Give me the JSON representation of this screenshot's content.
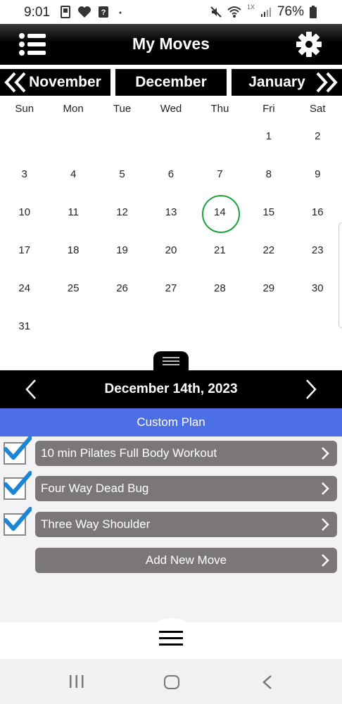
{
  "status": {
    "time": "9:01",
    "battery": "76%",
    "network_badge": "1X",
    "icons": [
      "phone-icon",
      "heart-shield-icon",
      "question-icon",
      "dot-icon",
      "mute-icon",
      "wifi-icon",
      "signal-icon",
      "battery-icon"
    ]
  },
  "header": {
    "title": "My Moves"
  },
  "months": {
    "prev": "November",
    "current": "December",
    "next": "January"
  },
  "weekdays": [
    "Sun",
    "Mon",
    "Tue",
    "Wed",
    "Thu",
    "Fri",
    "Sat"
  ],
  "calendar": {
    "weeks": [
      [
        "",
        "",
        "",
        "",
        "",
        "1",
        "2"
      ],
      [
        "3",
        "4",
        "5",
        "6",
        "7",
        "8",
        "9"
      ],
      [
        "10",
        "11",
        "12",
        "13",
        "14",
        "15",
        "16"
      ],
      [
        "17",
        "18",
        "19",
        "20",
        "21",
        "22",
        "23"
      ],
      [
        "24",
        "25",
        "26",
        "27",
        "28",
        "29",
        "30"
      ],
      [
        "31",
        "",
        "",
        "",
        "",
        "",
        ""
      ]
    ],
    "today": "14",
    "today_ring_color": "#1aa33a"
  },
  "selected_date": "December 14th, 2023",
  "plan": {
    "title": "Custom Plan",
    "color": "#4d6fe6"
  },
  "moves": [
    {
      "label": "10 min Pilates Full Body Workout",
      "checked": true
    },
    {
      "label": "Four Way Dead Bug",
      "checked": true
    },
    {
      "label": "Three Way Shoulder",
      "checked": true
    }
  ],
  "add_move_label": "Add New Move",
  "colors": {
    "check": "#1b86d4",
    "move_button": "#7b7778"
  }
}
